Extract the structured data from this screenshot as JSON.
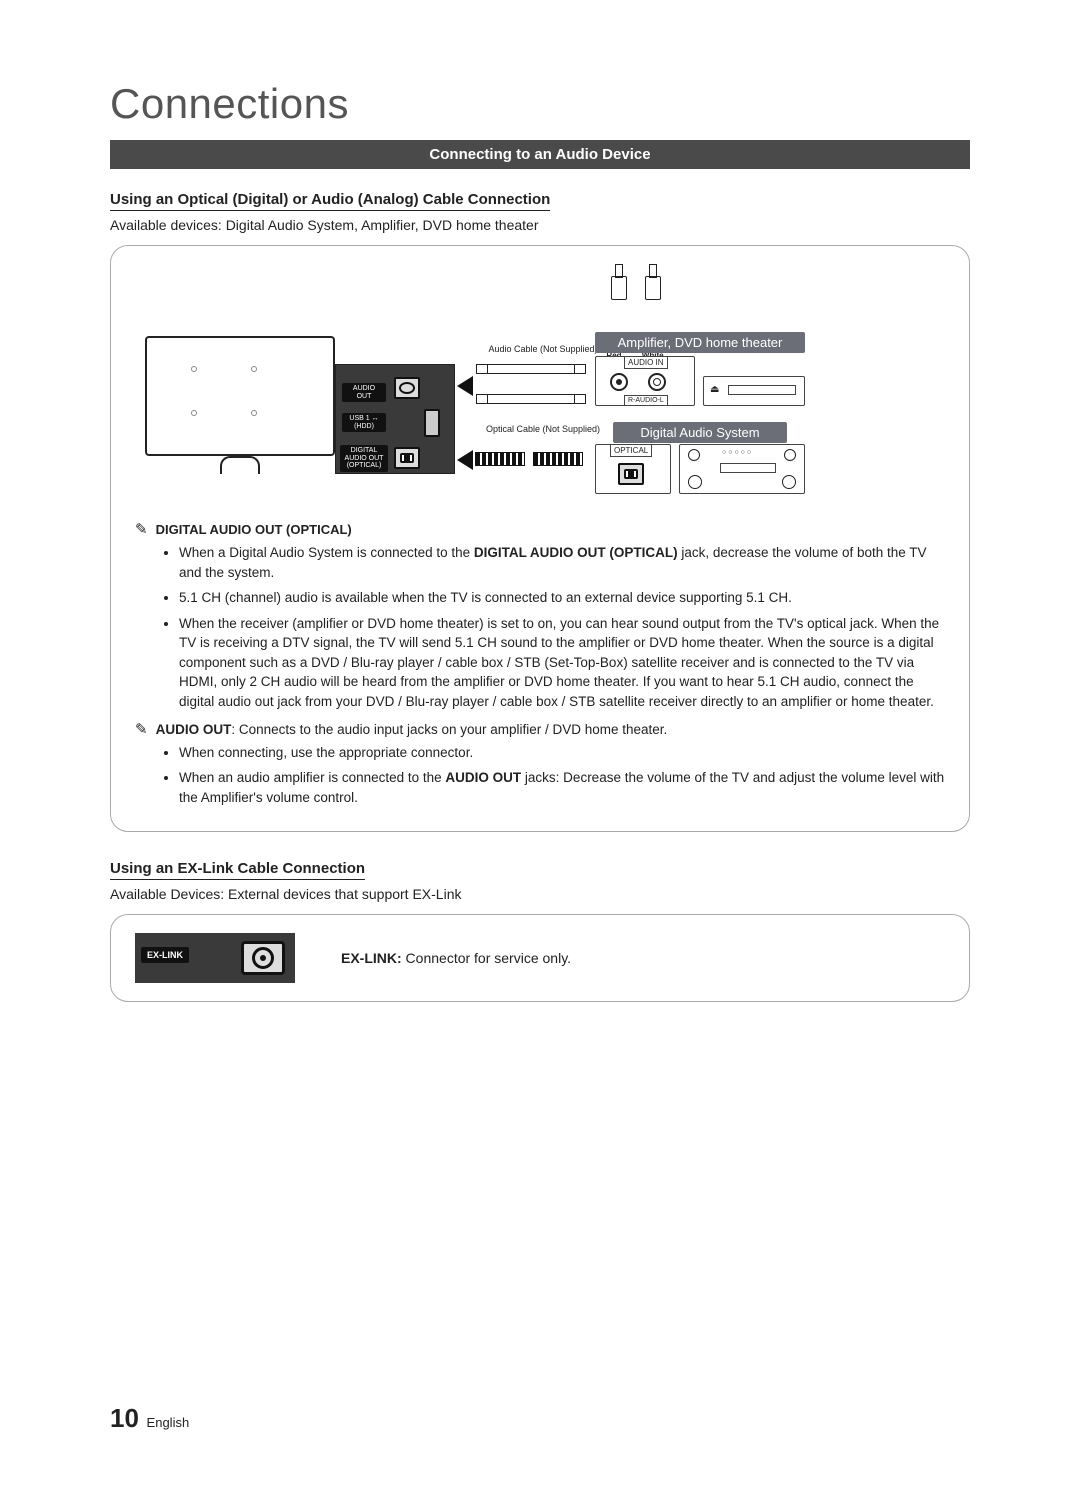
{
  "chapter": "Connections",
  "sectionBar": "Connecting to an Audio Device",
  "sub1": {
    "heading": "Using an Optical (Digital) or Audio (Analog) Cable Connection",
    "available": "Available devices: Digital Audio System, Amplifier, DVD home theater"
  },
  "diagram": {
    "rcaRed": "Red",
    "rcaWhite": "White",
    "audioCableLabel": "Audio Cable (Not Supplied)",
    "opticalCableLabel": "Optical Cable (Not Supplied)",
    "panelAudioOut": "AUDIO OUT",
    "panelUsb": "USB 1 ↔\n(HDD)",
    "panelDigitalOut": "DIGITAL\nAUDIO OUT\n(OPTICAL)",
    "ampTitle": "Amplifier, DVD home theater",
    "ampAudioIn": "AUDIO IN",
    "ampRAudioL": "R-AUDIO-L",
    "digitalTitle": "Digital Audio System",
    "digitalOptical": "OPTICAL"
  },
  "notes": {
    "digitalTitle": "DIGITAL AUDIO OUT (OPTICAL)",
    "digitalBullets": [
      {
        "pre": "When a Digital Audio System is connected to the ",
        "bold": "DIGITAL AUDIO OUT (OPTICAL)",
        "post": " jack, decrease the volume of both the TV and the system."
      },
      {
        "text": "5.1 CH (channel) audio is available when the TV is connected to an external device supporting 5.1 CH."
      },
      {
        "text": "When the receiver (amplifier or DVD home theater) is set to on, you can hear sound output from the TV's optical jack. When the TV is receiving a DTV signal, the TV will send 5.1 CH sound to the amplifier or DVD home theater. When the source is a digital component such as a DVD / Blu-ray player / cable box / STB (Set-Top-Box) satellite receiver and is connected to the TV via HDMI, only 2 CH audio will be heard from the amplifier or DVD home theater. If you want to hear 5.1 CH audio, connect the digital audio out jack from your DVD / Blu-ray player / cable box / STB satellite receiver directly to an amplifier or home theater."
      }
    ],
    "audioOutBold": "AUDIO OUT",
    "audioOutText": ": Connects to the audio input jacks on your amplifier / DVD home theater.",
    "audioOutBullets": [
      {
        "text": "When connecting, use the appropriate connector."
      },
      {
        "pre": "When an audio amplifier is connected to the ",
        "bold": "AUDIO OUT",
        "post": " jacks: Decrease the volume of the TV and adjust the volume level with the Amplifier's volume control."
      }
    ]
  },
  "sub2": {
    "heading": "Using an EX-Link Cable Connection",
    "available": "Available Devices: External devices that support EX-Link",
    "panelLabel": "EX-LINK",
    "descBold": "EX-LINK:",
    "desc": " Connector for service only."
  },
  "footer": {
    "page": "10",
    "lang": "English"
  }
}
